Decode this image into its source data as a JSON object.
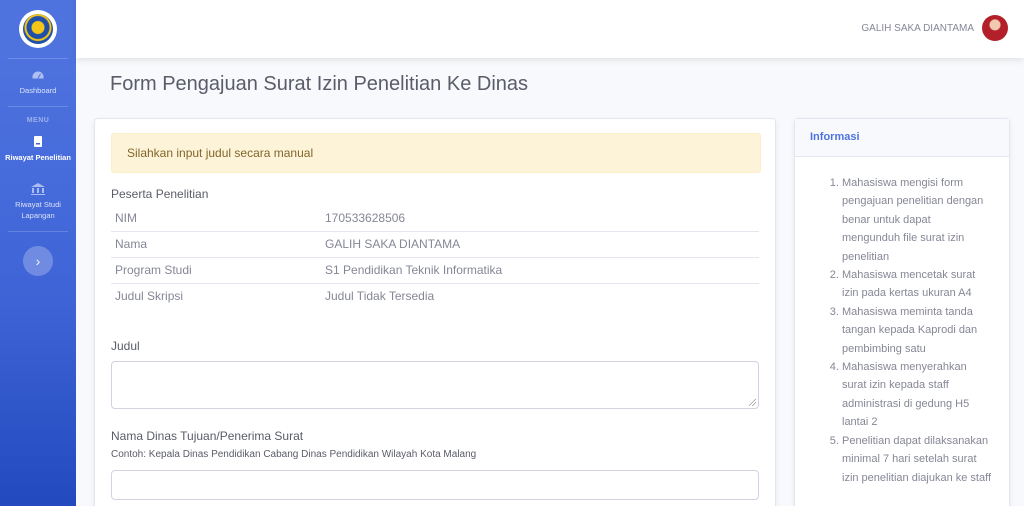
{
  "sidebar": {
    "dashboard_label": "Dashboard",
    "menu_heading": "MENU",
    "riwayat_penelitian_label": "Riwayat Penelitian",
    "riwayat_studi_label": "Riwayat Studi Lapangan",
    "toggle_icon": "›"
  },
  "topbar": {
    "user_name": "GALIH SAKA DIANTAMA"
  },
  "page": {
    "title": "Form Pengajuan Surat Izin Penelitian Ke Dinas"
  },
  "form": {
    "alert": "Silahkan input judul secara manual",
    "section_title": "Peserta Penelitian",
    "participant": [
      {
        "label": "NIM",
        "value": "170533628506"
      },
      {
        "label": "Nama",
        "value": "GALIH SAKA DIANTAMA"
      },
      {
        "label": "Program Studi",
        "value": "S1 Pendidikan Teknik Informatika"
      },
      {
        "label": "Judul Skripsi",
        "value": "Judul Tidak Tersedia"
      }
    ],
    "judul_label": "Judul",
    "judul_value": "",
    "dinas_label": "Nama Dinas Tujuan/Penerima Surat",
    "dinas_hint": "Contoh: Kepala Dinas Pendidikan Cabang Dinas Pendidikan Wilayah Kota Malang",
    "dinas_value": ""
  },
  "info": {
    "title": "Informasi",
    "items": [
      "Mahasiswa mengisi form pengajuan penelitian dengan benar untuk dapat mengunduh file surat izin penelitian",
      "Mahasiswa mencetak surat izin pada kertas ukuran A4",
      "Mahasiswa meminta tanda tangan kepada Kaprodi dan pembimbing satu",
      "Mahasiswa menyerahkan surat izin kepada staff administrasi di gedung H5 lantai 2",
      "Penelitian dapat dilaksanakan minimal 7 hari setelah surat izin penelitian diajukan ke staff"
    ]
  }
}
